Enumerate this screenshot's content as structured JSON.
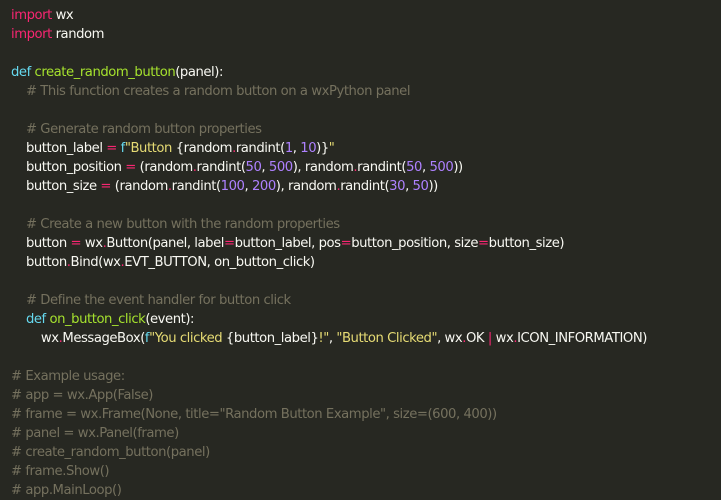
{
  "editor": {
    "language": "python",
    "lines": [
      [
        {
          "t": "import",
          "c": "#f92672"
        },
        {
          "t": " wx",
          "c": "#f8f8f2"
        }
      ],
      [
        {
          "t": "import",
          "c": "#f92672"
        },
        {
          "t": " random",
          "c": "#f8f8f2"
        }
      ],
      [],
      [
        {
          "t": "def",
          "c": "#66d9ef"
        },
        {
          "t": " ",
          "c": "#f8f8f2"
        },
        {
          "t": "create_random_button",
          "c": "#a6e22e"
        },
        {
          "t": "(panel):",
          "c": "#f8f8f2"
        }
      ],
      [
        {
          "t": "    # This function creates a random button on a wxPython panel",
          "c": "#75715e"
        }
      ],
      [],
      [
        {
          "t": "    # Generate random button properties",
          "c": "#75715e"
        }
      ],
      [
        {
          "t": "    button_label ",
          "c": "#f8f8f2"
        },
        {
          "t": "=",
          "c": "#f92672"
        },
        {
          "t": " f",
          "c": "#66d9ef"
        },
        {
          "t": "\"Button ",
          "c": "#e6db74"
        },
        {
          "t": "{random",
          "c": "#f8f8f2"
        },
        {
          "t": ".",
          "c": "#f92672"
        },
        {
          "t": "randint(",
          "c": "#f8f8f2"
        },
        {
          "t": "1",
          "c": "#ae81ff"
        },
        {
          "t": ", ",
          "c": "#f8f8f2"
        },
        {
          "t": "10",
          "c": "#ae81ff"
        },
        {
          "t": ")}",
          "c": "#f8f8f2"
        },
        {
          "t": "\"",
          "c": "#e6db74"
        }
      ],
      [
        {
          "t": "    button_position ",
          "c": "#f8f8f2"
        },
        {
          "t": "=",
          "c": "#f92672"
        },
        {
          "t": " (random",
          "c": "#f8f8f2"
        },
        {
          "t": ".",
          "c": "#f92672"
        },
        {
          "t": "randint(",
          "c": "#f8f8f2"
        },
        {
          "t": "50",
          "c": "#ae81ff"
        },
        {
          "t": ", ",
          "c": "#f8f8f2"
        },
        {
          "t": "500",
          "c": "#ae81ff"
        },
        {
          "t": "), random",
          "c": "#f8f8f2"
        },
        {
          "t": ".",
          "c": "#f92672"
        },
        {
          "t": "randint(",
          "c": "#f8f8f2"
        },
        {
          "t": "50",
          "c": "#ae81ff"
        },
        {
          "t": ", ",
          "c": "#f8f8f2"
        },
        {
          "t": "500",
          "c": "#ae81ff"
        },
        {
          "t": "))",
          "c": "#f8f8f2"
        }
      ],
      [
        {
          "t": "    button_size ",
          "c": "#f8f8f2"
        },
        {
          "t": "=",
          "c": "#f92672"
        },
        {
          "t": " (random",
          "c": "#f8f8f2"
        },
        {
          "t": ".",
          "c": "#f92672"
        },
        {
          "t": "randint(",
          "c": "#f8f8f2"
        },
        {
          "t": "100",
          "c": "#ae81ff"
        },
        {
          "t": ", ",
          "c": "#f8f8f2"
        },
        {
          "t": "200",
          "c": "#ae81ff"
        },
        {
          "t": "), random",
          "c": "#f8f8f2"
        },
        {
          "t": ".",
          "c": "#f92672"
        },
        {
          "t": "randint(",
          "c": "#f8f8f2"
        },
        {
          "t": "30",
          "c": "#ae81ff"
        },
        {
          "t": ", ",
          "c": "#f8f8f2"
        },
        {
          "t": "50",
          "c": "#ae81ff"
        },
        {
          "t": "))",
          "c": "#f8f8f2"
        }
      ],
      [],
      [
        {
          "t": "    # Create a new button with the random properties",
          "c": "#75715e"
        }
      ],
      [
        {
          "t": "    button ",
          "c": "#f8f8f2"
        },
        {
          "t": "=",
          "c": "#f92672"
        },
        {
          "t": " wx",
          "c": "#f8f8f2"
        },
        {
          "t": ".",
          "c": "#f92672"
        },
        {
          "t": "Button(panel, label",
          "c": "#f8f8f2"
        },
        {
          "t": "=",
          "c": "#f92672"
        },
        {
          "t": "button_label, pos",
          "c": "#f8f8f2"
        },
        {
          "t": "=",
          "c": "#f92672"
        },
        {
          "t": "button_position, size",
          "c": "#f8f8f2"
        },
        {
          "t": "=",
          "c": "#f92672"
        },
        {
          "t": "button_size)",
          "c": "#f8f8f2"
        }
      ],
      [
        {
          "t": "    button",
          "c": "#f8f8f2"
        },
        {
          "t": ".",
          "c": "#f92672"
        },
        {
          "t": "Bind(wx",
          "c": "#f8f8f2"
        },
        {
          "t": ".",
          "c": "#f92672"
        },
        {
          "t": "EVT_BUTTON, on_button_click)",
          "c": "#f8f8f2"
        }
      ],
      [],
      [
        {
          "t": "    # Define the event handler for button click",
          "c": "#75715e"
        }
      ],
      [
        {
          "t": "    ",
          "c": "#f8f8f2"
        },
        {
          "t": "def",
          "c": "#66d9ef"
        },
        {
          "t": " ",
          "c": "#f8f8f2"
        },
        {
          "t": "on_button_click",
          "c": "#a6e22e"
        },
        {
          "t": "(event):",
          "c": "#f8f8f2"
        }
      ],
      [
        {
          "t": "        wx",
          "c": "#f8f8f2"
        },
        {
          "t": ".",
          "c": "#f92672"
        },
        {
          "t": "MessageBox(",
          "c": "#f8f8f2"
        },
        {
          "t": "f",
          "c": "#66d9ef"
        },
        {
          "t": "\"You clicked ",
          "c": "#e6db74"
        },
        {
          "t": "{button_label}",
          "c": "#f8f8f2"
        },
        {
          "t": "!\"",
          "c": "#e6db74"
        },
        {
          "t": ", ",
          "c": "#f8f8f2"
        },
        {
          "t": "\"Button Clicked\"",
          "c": "#e6db74"
        },
        {
          "t": ", wx",
          "c": "#f8f8f2"
        },
        {
          "t": ".",
          "c": "#f92672"
        },
        {
          "t": "OK ",
          "c": "#f8f8f2"
        },
        {
          "t": "|",
          "c": "#f92672"
        },
        {
          "t": " wx",
          "c": "#f8f8f2"
        },
        {
          "t": ".",
          "c": "#f92672"
        },
        {
          "t": "ICON_INFORMATION)",
          "c": "#f8f8f2"
        }
      ],
      [],
      [
        {
          "t": "# Example usage:",
          "c": "#75715e"
        }
      ],
      [
        {
          "t": "# app = wx.App(False)",
          "c": "#75715e"
        }
      ],
      [
        {
          "t": "# frame = wx.Frame(None, title=\"Random Button Example\", size=(600, 400))",
          "c": "#75715e"
        }
      ],
      [
        {
          "t": "# panel = wx.Panel(frame)",
          "c": "#75715e"
        }
      ],
      [
        {
          "t": "# create_random_button(panel)",
          "c": "#75715e"
        }
      ],
      [
        {
          "t": "# frame.Show()",
          "c": "#75715e"
        }
      ],
      [
        {
          "t": "# app.MainLoop()",
          "c": "#75715e"
        }
      ]
    ]
  }
}
